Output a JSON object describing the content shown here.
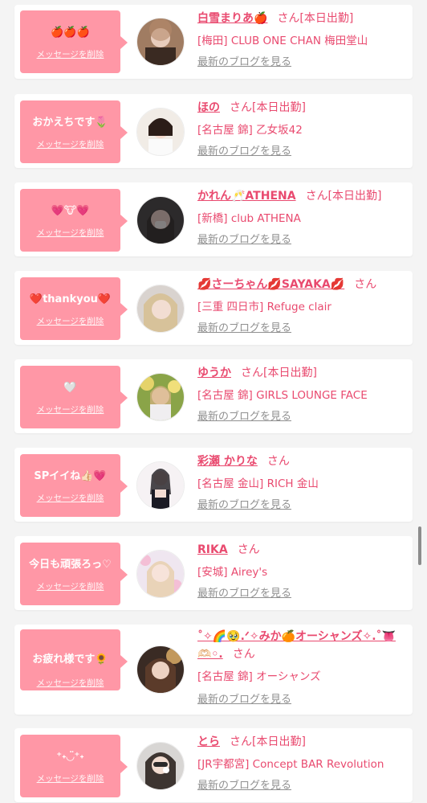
{
  "theme": {
    "accent": "#e94a6f",
    "bubble": "#ff97a6",
    "link_gray": "#909090"
  },
  "cards": [
    {
      "message": "🍎🍎🍎",
      "delete_label": "メッセージを削除",
      "name": "白雪まりあ🍎",
      "suffix": "さん[本日出勤]",
      "shop": "[梅田] CLUB ONE CHAN 梅田堂山",
      "blog": "最新のブログを見る",
      "avatar": "avatar-1"
    },
    {
      "message": "おかえちです🌷",
      "delete_label": "メッセージを削除",
      "name": "ほの",
      "suffix": "さん[本日出勤]",
      "shop": "[名古屋 錦] 乙女坂42",
      "blog": "最新のブログを見る",
      "avatar": "avatar-2"
    },
    {
      "message": "💗🐮💗",
      "delete_label": "メッセージを削除",
      "name": "かれん🥂ATHENA",
      "suffix": "さん[本日出勤]",
      "shop": "[新橋] club ATHENA",
      "blog": "最新のブログを見る",
      "avatar": "avatar-3"
    },
    {
      "message": "❤️thankyou❤️",
      "delete_label": "メッセージを削除",
      "name": "💋さーちゃん💋SAYAKA💋",
      "suffix": "さん",
      "shop": "[三重 四日市] Refuge clair",
      "blog": "最新のブログを見る",
      "avatar": "avatar-4"
    },
    {
      "message": "🤍",
      "delete_label": "メッセージを削除",
      "name": "ゆうか",
      "suffix": "さん[本日出勤]",
      "shop": "[名古屋 錦] GIRLS LOUNGE FACE",
      "blog": "最新のブログを見る",
      "avatar": "avatar-5"
    },
    {
      "message": "SPイイね👍🏻💗",
      "delete_label": "メッセージを削除",
      "name": "彩瀬 かりな",
      "suffix": "さん",
      "shop": "[名古屋 金山] RICH 金山",
      "blog": "最新のブログを見る",
      "avatar": "avatar-6"
    },
    {
      "message": "今日も頑張ろっ♡",
      "delete_label": "メッセージを削除",
      "name": "RIKA",
      "suffix": "さん",
      "shop": "[安城] Airey's",
      "blog": "最新のブログを見る",
      "avatar": "avatar-7"
    },
    {
      "message": "お疲れ様です🌻",
      "delete_label": "メッセージを削除",
      "name": "˚✧🌈🥹.ᐟ✧みか🍊オーシャンズ✧.˚👅",
      "name2": "🫶🏻◦.",
      "suffix": "さん",
      "shop": "[名古屋 錦] オーシャンズ",
      "blog": "最新のブログを見る",
      "avatar": "avatar-8"
    },
    {
      "message": "⁺˖◡̈⁺˖",
      "delete_label": "メッセージを削除",
      "name": "とら",
      "suffix": "さん[本日出勤]",
      "shop": "[JR宇都宮] Concept BAR Revolution",
      "blog": "最新のブログを見る",
      "avatar": "avatar-9"
    }
  ]
}
